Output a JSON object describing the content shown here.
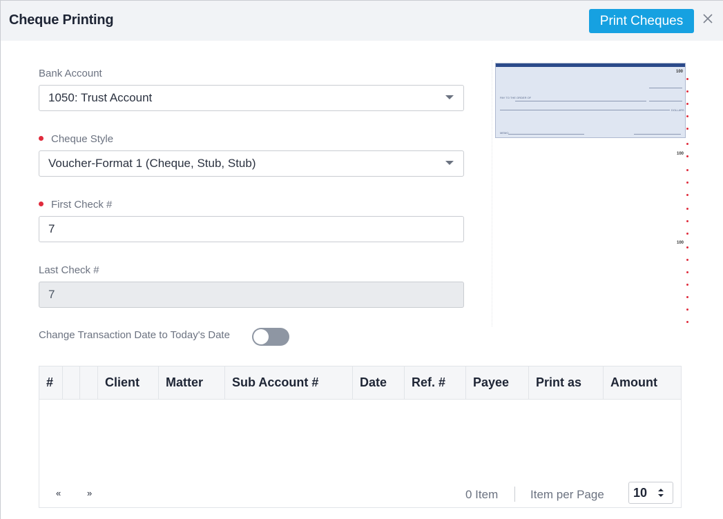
{
  "header": {
    "title": "Cheque Printing",
    "print_button": "Print Cheques"
  },
  "form": {
    "bank_account": {
      "label": "Bank Account",
      "value": "1050: Trust Account"
    },
    "cheque_style": {
      "label": "Cheque Style",
      "value": "Voucher-Format 1 (Cheque, Stub, Stub)",
      "required": true
    },
    "first_check": {
      "label": "First Check #",
      "value": "7",
      "required": true
    },
    "last_check": {
      "label": "Last Check #",
      "value": "7",
      "disabled": true
    },
    "change_date": {
      "label": "Change Transaction Date to Today's Date",
      "checked": false
    }
  },
  "preview": {
    "cheque_number": "100",
    "stub_number_1": "100",
    "stub_number_2": "100",
    "pay_to_text": "PAY TO THE ORDER OF",
    "dollars_text": "DOLLARS",
    "memo_text": "MEMO"
  },
  "table": {
    "columns": [
      "#",
      "",
      "",
      "Client",
      "Matter",
      "Sub Account #",
      "Date",
      "Ref. #",
      "Payee",
      "Print as",
      "Amount"
    ],
    "rows": []
  },
  "pager": {
    "prev": "«",
    "next": "»",
    "item_count": "0 Item",
    "per_page_label": "Item per Page",
    "per_page_value": "10"
  },
  "colors": {
    "accent": "#16a1e1",
    "required": "#e02b3c",
    "header_bg": "#f1f3f6"
  }
}
